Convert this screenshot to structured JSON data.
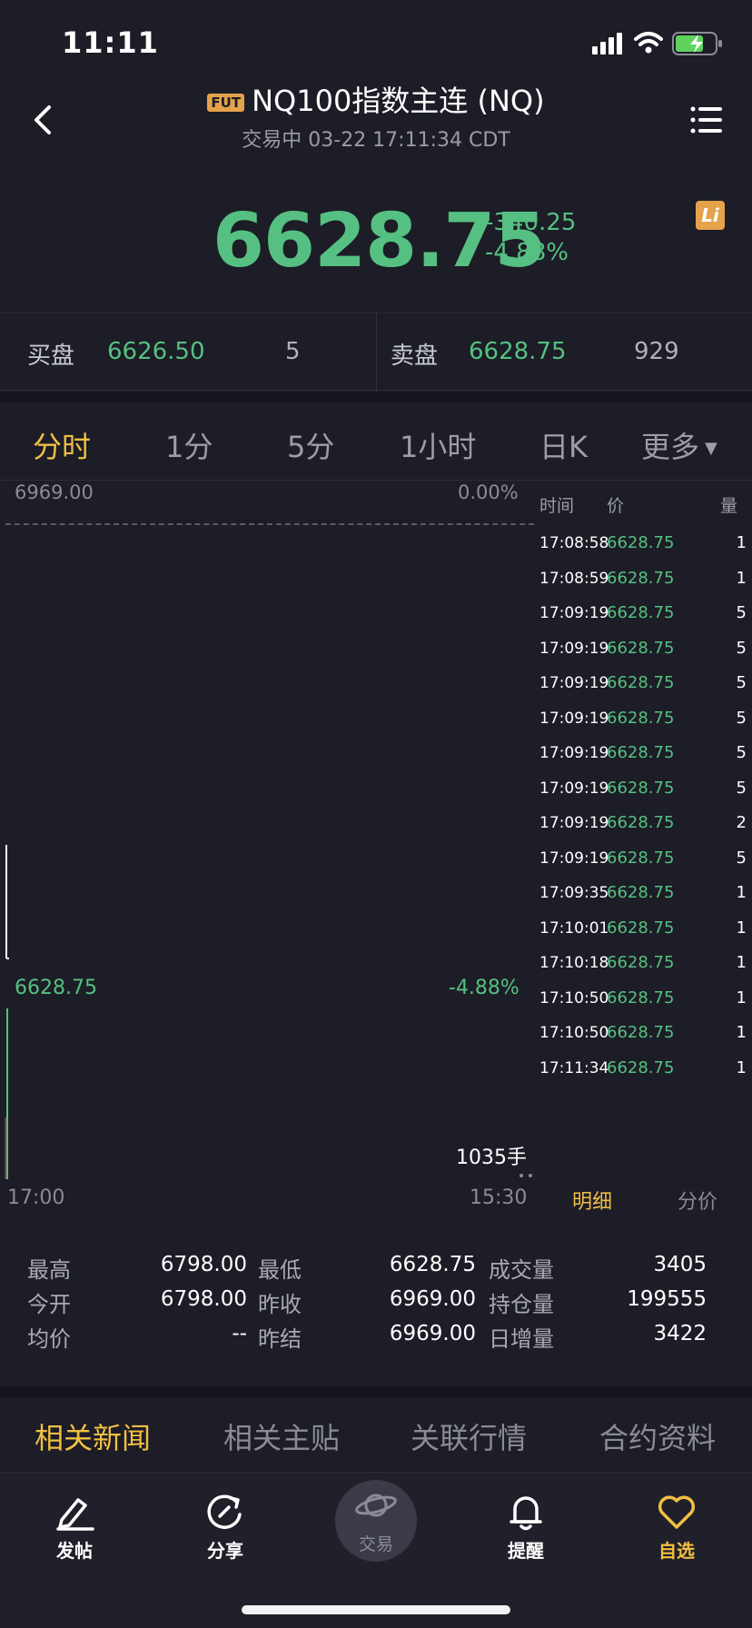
{
  "status_bar": {
    "time": "11:11"
  },
  "header": {
    "badge": "FUT",
    "title": "NQ100指数主连 (NQ)",
    "trade_status": "交易中 03-22 17:11:34 CDT"
  },
  "quote": {
    "last_price": "6628.75",
    "change": "-340.25",
    "change_pct": "-4.88%",
    "li_label": "Li"
  },
  "bid_ask": {
    "bid_label": "买盘",
    "bid_price": "6626.50",
    "bid_volume": "5",
    "ask_label": "卖盘",
    "ask_price": "6628.75",
    "ask_volume": "929"
  },
  "period_tabs": [
    {
      "label": "分时",
      "active": true
    },
    {
      "label": "1分",
      "active": false
    },
    {
      "label": "5分",
      "active": false
    },
    {
      "label": "1小时",
      "active": false
    },
    {
      "label": "日K",
      "active": false
    },
    {
      "label": "更多",
      "active": false
    }
  ],
  "chart": {
    "top_price": "6969.00",
    "top_pct": "0.00%",
    "mid_price": "6628.75",
    "mid_pct": "-4.88%",
    "volume": "1035手",
    "time_start": "17:00",
    "time_end": "15:30"
  },
  "trades": {
    "headers": {
      "time": "时间",
      "price": "价",
      "volume": "量"
    },
    "rows": [
      {
        "time": "17:08:58",
        "price": "6628.75",
        "volume": "1"
      },
      {
        "time": "17:08:59",
        "price": "6628.75",
        "volume": "1"
      },
      {
        "time": "17:09:19",
        "price": "6628.75",
        "volume": "5"
      },
      {
        "time": "17:09:19",
        "price": "6628.75",
        "volume": "5"
      },
      {
        "time": "17:09:19",
        "price": "6628.75",
        "volume": "5"
      },
      {
        "time": "17:09:19",
        "price": "6628.75",
        "volume": "5"
      },
      {
        "time": "17:09:19",
        "price": "6628.75",
        "volume": "5"
      },
      {
        "time": "17:09:19",
        "price": "6628.75",
        "volume": "5"
      },
      {
        "time": "17:09:19",
        "price": "6628.75",
        "volume": "2"
      },
      {
        "time": "17:09:19",
        "price": "6628.75",
        "volume": "5"
      },
      {
        "time": "17:09:35",
        "price": "6628.75",
        "volume": "1"
      },
      {
        "time": "17:10:01",
        "price": "6628.75",
        "volume": "1"
      },
      {
        "time": "17:10:18",
        "price": "6628.75",
        "volume": "1"
      },
      {
        "time": "17:10:50",
        "price": "6628.75",
        "volume": "1"
      },
      {
        "time": "17:10:50",
        "price": "6628.75",
        "volume": "1"
      },
      {
        "time": "17:11:34",
        "price": "6628.75",
        "volume": "1"
      }
    ],
    "tab_detail": "明细",
    "tab_price": "分价"
  },
  "stats": {
    "high_label": "最高",
    "high": "6798.00",
    "low_label": "最低",
    "low": "6628.75",
    "volume_label": "成交量",
    "volume": "3405",
    "open_label": "今开",
    "open": "6798.00",
    "prev_close_label": "昨收",
    "prev_close": "6969.00",
    "open_interest_label": "持仓量",
    "open_interest": "199555",
    "avg_label": "均价",
    "avg": "--",
    "prev_settle_label": "昨结",
    "prev_settle": "6969.00",
    "oi_change_label": "日增量",
    "oi_change": "3422"
  },
  "info_tabs": [
    {
      "label": "相关新闻",
      "active": true
    },
    {
      "label": "相关主贴",
      "active": false
    },
    {
      "label": "关联行情",
      "active": false
    },
    {
      "label": "合约资料",
      "active": false
    }
  ],
  "bottom_nav": {
    "post": "发帖",
    "share": "分享",
    "trade": "交易",
    "alert": "提醒",
    "watchlist": "自选"
  },
  "colors": {
    "accent": "#f2bf43",
    "down": "#55c082",
    "background": "#1c1d26"
  }
}
